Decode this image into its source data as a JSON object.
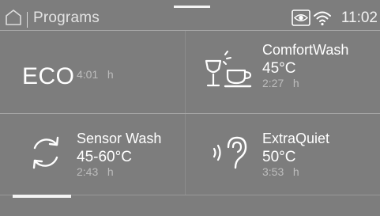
{
  "header": {
    "title": "Programs",
    "time": "11:02"
  },
  "programs": [
    {
      "name": "ECO",
      "temperature": "",
      "duration": "4:01",
      "duration_unit": "h",
      "icon": "eco-text",
      "selected": true
    },
    {
      "name": "ComfortWash",
      "temperature": "45°C",
      "duration": "2:27",
      "duration_unit": "h",
      "icon": "glass-cup-icon"
    },
    {
      "name": "Sensor Wash",
      "temperature": "45-60°C",
      "duration": "2:43",
      "duration_unit": "h",
      "icon": "sync-arrows-icon"
    },
    {
      "name": "ExtraQuiet",
      "temperature": "50°C",
      "duration": "3:53",
      "duration_unit": "h",
      "icon": "quiet-ear-icon"
    }
  ],
  "scroll": {
    "position": 0.0
  },
  "colors": {
    "background": "#7d7d7d",
    "text": "#ffffff",
    "secondary_text": "#bdbdbd",
    "divider": "#a6a6a6"
  }
}
